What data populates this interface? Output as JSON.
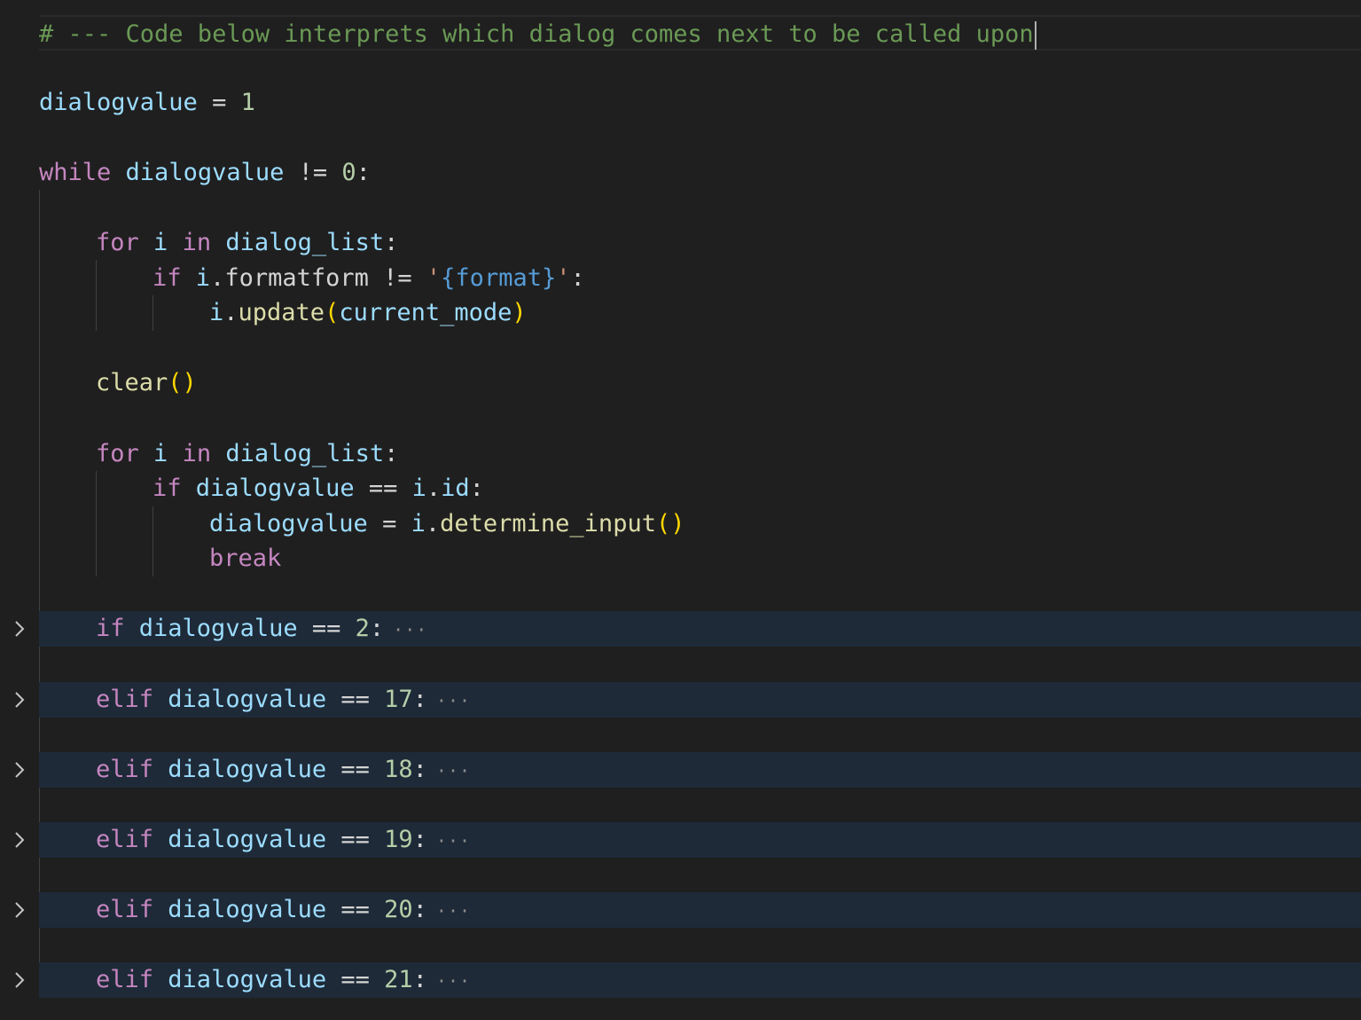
{
  "editor": {
    "theme_colors": {
      "background": "#1f1f1f",
      "folded_line_background": "#1e2a38",
      "comment": "#6a9955",
      "keyword": "#c586c0",
      "variable": "#9cdcfe",
      "number": "#b5cea8",
      "function": "#dcdcaa",
      "string": "#ce9178",
      "bracket": "#ffd700"
    },
    "fold_icon": "chevron-right-icon",
    "ellipsis_text": "···",
    "lines": {
      "l1": {
        "comment": "# --- Code below interprets which dialog comes next to be called upon"
      },
      "l3": {
        "var": "dialogvalue",
        "op": " = ",
        "num": "1"
      },
      "l5": {
        "kw": "while",
        "var": "dialogvalue",
        "op": " != ",
        "num": "0",
        "colon": ":"
      },
      "l7": {
        "kw1": "for",
        "var1": "i",
        "kw2": "in",
        "var2": "dialog_list",
        "colon": ":"
      },
      "l8": {
        "kw": "if",
        "var1": "i",
        "dot": ".",
        "var2": "formatform",
        "op": " != ",
        "q1": "'",
        "fmt": "{format}",
        "q2": "'",
        "colon": ":"
      },
      "l9": {
        "var1": "i",
        "dot": ".",
        "func": "update",
        "open": "(",
        "var2": "current_mode",
        "close": ")"
      },
      "l11": {
        "func": "clear",
        "open": "(",
        "close": ")"
      },
      "l13": {
        "kw1": "for",
        "var1": "i",
        "kw2": "in",
        "var2": "dialog_list",
        "colon": ":"
      },
      "l14": {
        "kw": "if",
        "var1": "dialogvalue",
        "op": " == ",
        "var2": "i",
        "dot": ".",
        "var3": "id",
        "colon": ":"
      },
      "l15": {
        "var1": "dialogvalue",
        "op": " = ",
        "var2": "i",
        "dot": ".",
        "func": "determine_input",
        "open": "(",
        "close": ")"
      },
      "l16": {
        "kw": "break"
      },
      "f1": {
        "kw": "if",
        "var": "dialogvalue",
        "op": " == ",
        "num": "2",
        "colon": ":"
      },
      "f2": {
        "kw": "elif",
        "var": "dialogvalue",
        "op": " == ",
        "num": "17",
        "colon": ":"
      },
      "f3": {
        "kw": "elif",
        "var": "dialogvalue",
        "op": " == ",
        "num": "18",
        "colon": ":"
      },
      "f4": {
        "kw": "elif",
        "var": "dialogvalue",
        "op": " == ",
        "num": "19",
        "colon": ":"
      },
      "f5": {
        "kw": "elif",
        "var": "dialogvalue",
        "op": " == ",
        "num": "20",
        "colon": ":"
      },
      "f6": {
        "kw": "elif",
        "var": "dialogvalue",
        "op": " == ",
        "num": "21",
        "colon": ":"
      }
    }
  }
}
